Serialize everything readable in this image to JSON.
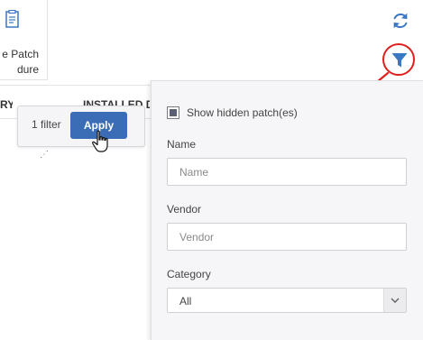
{
  "procedure_card": {
    "label_line1": "e Patch",
    "label_line2": "dure"
  },
  "table_header": {
    "col1": "RY",
    "col2": "INSTALLED DI"
  },
  "filter_chip": {
    "count_text": "1 filter",
    "apply_label": "Apply"
  },
  "panel": {
    "show_hidden_label": "Show hidden patch(es)",
    "show_hidden_checked": "indeterminate",
    "name": {
      "label": "Name",
      "placeholder": "Name",
      "value": ""
    },
    "vendor": {
      "label": "Vendor",
      "placeholder": "Vendor",
      "value": ""
    },
    "category": {
      "label": "Category",
      "selected": "All"
    }
  },
  "icons": {
    "refresh": "refresh-icon",
    "filter": "filter-icon",
    "procedure": "document-icon",
    "cursor": "hand-pointer-icon"
  },
  "colors": {
    "accent": "#3b6db7",
    "highlight": "#e0201c",
    "icon_blue": "#3a78c3"
  }
}
